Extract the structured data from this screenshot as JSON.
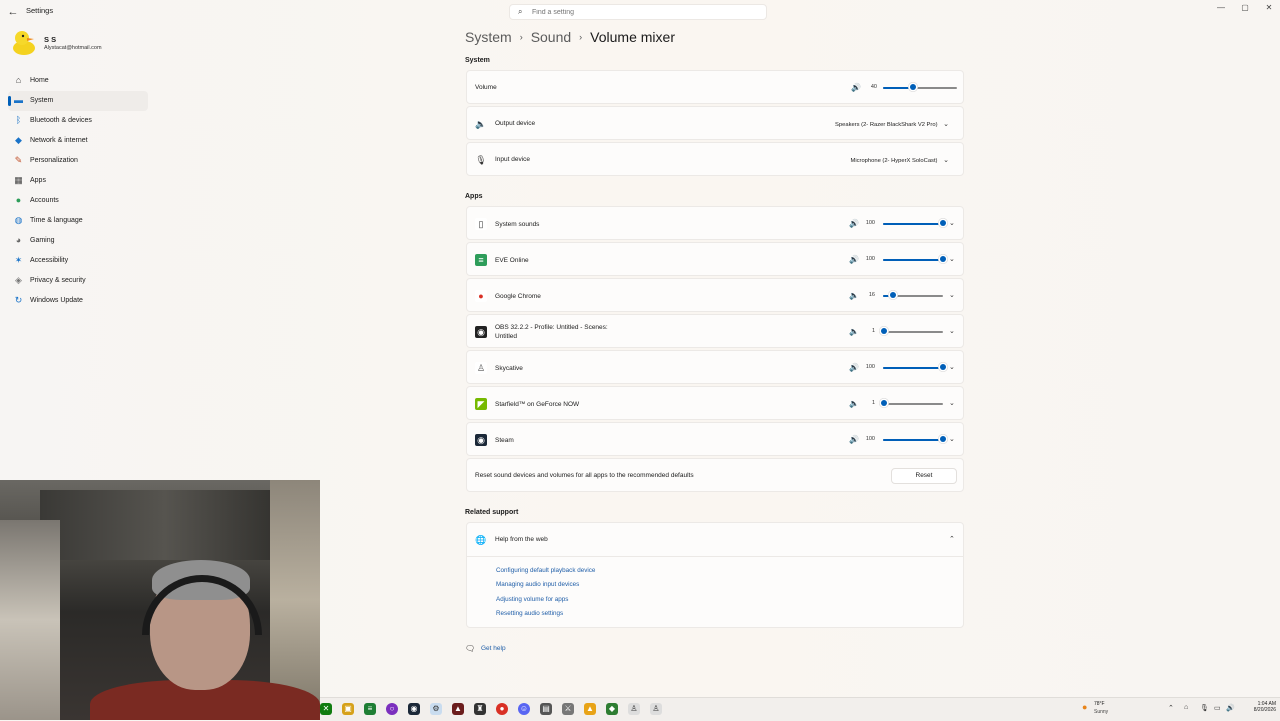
{
  "window": {
    "title": "Settings"
  },
  "search": {
    "placeholder": "Find a setting"
  },
  "profile": {
    "name": "S S",
    "email": "Alystacat@hotmail.com"
  },
  "nav": [
    {
      "label": "Home",
      "icon": "home-icon",
      "active": false
    },
    {
      "label": "System",
      "icon": "system-icon",
      "active": true
    },
    {
      "label": "Bluetooth & devices",
      "icon": "bluetooth-icon",
      "active": false
    },
    {
      "label": "Network & internet",
      "icon": "wifi-icon",
      "active": false
    },
    {
      "label": "Personalization",
      "icon": "brush-icon",
      "active": false
    },
    {
      "label": "Apps",
      "icon": "apps-icon",
      "active": false
    },
    {
      "label": "Accounts",
      "icon": "accounts-icon",
      "active": false
    },
    {
      "label": "Time & language",
      "icon": "globe-clock-icon",
      "active": false
    },
    {
      "label": "Gaming",
      "icon": "gamepad-icon",
      "active": false
    },
    {
      "label": "Accessibility",
      "icon": "accessibility-icon",
      "active": false
    },
    {
      "label": "Privacy & security",
      "icon": "shield-icon",
      "active": false
    },
    {
      "label": "Windows Update",
      "icon": "update-icon",
      "active": false
    }
  ],
  "breadcrumb": {
    "items": [
      "System",
      "Sound",
      "Volume mixer"
    ],
    "separator": "›"
  },
  "system_section": {
    "heading": "System",
    "volume": {
      "label": "Volume",
      "value": "40",
      "level": 40
    },
    "output": {
      "label": "Output device",
      "selected": "Speakers (2- Razer BlackShark V2 Pro)"
    },
    "input": {
      "label": "Input device",
      "selected": "Microphone (2- HyperX SoloCast)"
    }
  },
  "apps_section": {
    "heading": "Apps",
    "apps": [
      {
        "name": "System sounds",
        "value": "100",
        "level": 100,
        "icon": "system-sounds-icon"
      },
      {
        "name": "EVE Online",
        "value": "100",
        "level": 100,
        "icon": "eve-online-icon"
      },
      {
        "name": "Google Chrome",
        "value": "16",
        "level": 16,
        "icon": "chrome-icon"
      },
      {
        "name": "OBS 32.2.2 - Profile: Untitled - Scenes: Untitled",
        "value": "1",
        "level": 1,
        "icon": "obs-icon"
      },
      {
        "name": "Skycative",
        "value": "100",
        "level": 100,
        "icon": "skycative-icon"
      },
      {
        "name": "Starfield™ on GeForce NOW",
        "value": "1",
        "level": 1,
        "icon": "geforce-now-icon"
      },
      {
        "name": "Steam",
        "value": "100",
        "level": 100,
        "icon": "steam-icon"
      }
    ],
    "reset": {
      "text": "Reset sound devices and volumes for all apps to the recommended defaults",
      "button": "Reset"
    }
  },
  "related": {
    "heading": "Related support",
    "help_title": "Help from the web",
    "links": [
      "Configuring default playback device",
      "Managing audio input devices",
      "Adjusting volume for apps",
      "Resetting audio settings"
    ],
    "get_help": "Get help"
  },
  "taskbar": {
    "weather": {
      "temp": "78°F",
      "cond": "Sunny"
    },
    "clock": {
      "time": "1:04 AM",
      "date": "8/20/2026"
    }
  },
  "colors": {
    "accent": "#005fb8",
    "link": "#1f5ea8"
  }
}
